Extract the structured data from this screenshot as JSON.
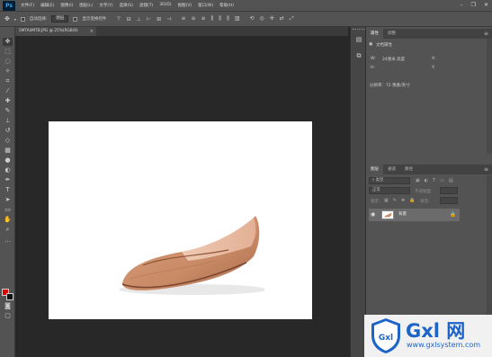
{
  "app": {
    "logo": "Ps"
  },
  "menu": {
    "items": [
      "文件(F)",
      "编辑(E)",
      "图像(I)",
      "图层(L)",
      "文字(Y)",
      "选择(S)",
      "滤镜(T)",
      "3D(D)",
      "视图(V)",
      "窗口(W)",
      "帮助(H)"
    ]
  },
  "window_controls": {
    "minimize": "–",
    "restore": "❐",
    "close": "✕"
  },
  "options": {
    "auto_select_label": "自动选择:",
    "auto_select_target": "图层",
    "show_transform_label": "显示变换控件"
  },
  "document": {
    "tab_label": "5MTA4MTB.JPG @ 25%(RGB/8)",
    "tab_close": "×"
  },
  "properties_panel": {
    "tabs": [
      "属性",
      "调整"
    ],
    "doc_properties_label": "文档属性",
    "width_label": "W:",
    "width_value": "24厘米 高度",
    "height_label": "H:",
    "x_label": "X:",
    "y_label": "Y:",
    "resolution_text": "分辨率：72 像素/英寸"
  },
  "layers_panel": {
    "tabs": [
      "图层",
      "通道",
      "路径"
    ],
    "kind_placeholder": "类型",
    "blend_mode": "正常",
    "opacity_label": "不透明度:",
    "lock_label": "锁定:",
    "fill_label": "填充:",
    "layer_name": "背景"
  },
  "watermark": {
    "shield_text": "Gxl",
    "brand": "Gxl 网",
    "url": "www.gxlsystem.com"
  },
  "colors": {
    "foreground": "#e00000",
    "background": "#111111",
    "ps_blue": "#31a8ff",
    "watermark_blue": "#1c64c8"
  }
}
